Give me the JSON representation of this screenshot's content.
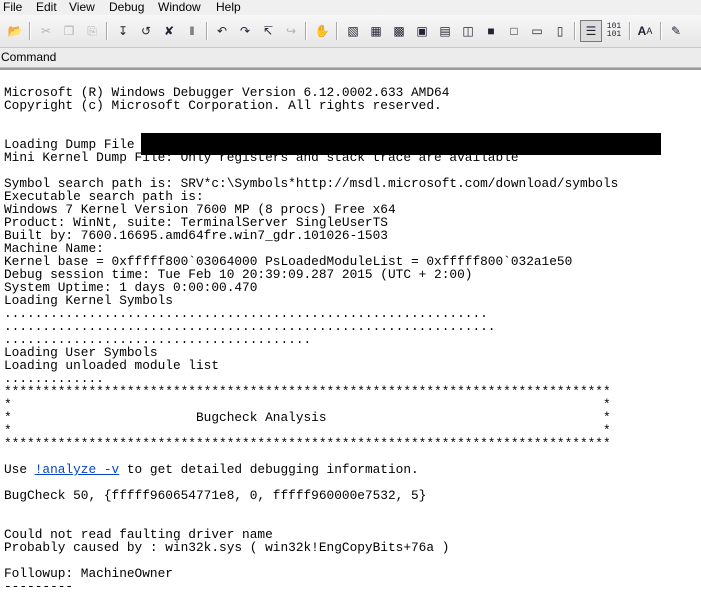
{
  "menu": [
    "File",
    "Edit",
    "View",
    "Debug",
    "Window",
    "Help"
  ],
  "window_title": "Command",
  "output": {
    "version_line": "Microsoft (R) Windows Debugger Version 6.12.0002.633 AMD64",
    "copyright_line": "Copyright (c) Microsoft Corporation. All rights reserved.",
    "loading_dump": "Loading Dump File",
    "mini_kernel": "Mini Kernel Dump File: Only registers and stack trace are available",
    "symbol_path": "Symbol search path is: SRV*c:\\Symbols*http://msdl.microsoft.com/download/symbols",
    "exe_path": "Executable search path is:",
    "windows_version": "Windows 7 Kernel Version 7600 MP (8 procs) Free x64",
    "product": "Product: WinNt, suite: TerminalServer SingleUserTS",
    "built_by": "Built by: 7600.16695.amd64fre.win7_gdr.101026-1503",
    "machine_name": "Machine Name:",
    "kernel_base": "Kernel base = 0xfffff800`03064000 PsLoadedModuleList = 0xfffff800`032a1e50",
    "debug_session": "Debug session time: Tue Feb 10 20:39:09.287 2015 (UTC + 2:00)",
    "uptime": "System Uptime: 1 days 0:00:00.470",
    "loading_kernel": "Loading Kernel Symbols",
    "dots1": "...............................................................",
    "dots2": "................................................................",
    "dots3": "........................................",
    "loading_user": "Loading User Symbols",
    "loading_unloaded": "Loading unloaded module list",
    "dots4": ".............",
    "stars": "*******************************************************************************",
    "star_edge": "*                                                                             *",
    "bugcheck_title_line": "*                        Bugcheck Analysis                                    *",
    "use_prefix": "Use ",
    "analyze_link": "!analyze -v",
    "use_suffix": " to get detailed debugging information.",
    "bugcheck": "BugCheck 50, {fffff960654771e8, 0, fffff960000e7532, 5}",
    "could_not_read": "Could not read faulting driver name",
    "probably_caused": "Probably caused by : win32k.sys ( win32k!EngCopyBits+76a )",
    "followup": "Followup: MachineOwner",
    "dashes": "---------"
  }
}
